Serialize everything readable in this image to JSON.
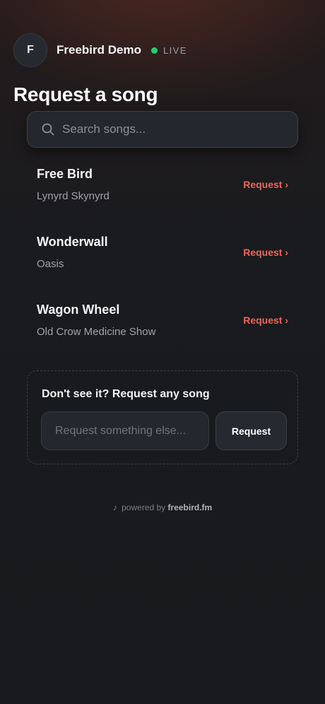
{
  "header": {
    "avatar_initial": "F",
    "name": "Freebird Demo",
    "live_label": "LIVE",
    "live_color": "#2ecc71"
  },
  "page": {
    "title": "Request a song"
  },
  "search": {
    "placeholder": "Search songs...",
    "icon": "search-icon"
  },
  "songs": [
    {
      "title": "Free Bird",
      "artist": "Lynyrd Skynyrd",
      "action": "Request ›"
    },
    {
      "title": "Wonderwall",
      "artist": "Oasis",
      "action": "Request ›"
    },
    {
      "title": "Wagon Wheel",
      "artist": "Old Crow Medicine Show",
      "action": "Request ›"
    }
  ],
  "custom_request": {
    "label": "Don't see it? Request any song",
    "placeholder": "Request something else...",
    "button_label": "Request"
  },
  "footer": {
    "note_icon": "♪",
    "prefix": "powered by",
    "brand": "freebird.fm"
  },
  "colors": {
    "accent": "#e8685b",
    "background": "#17191c"
  }
}
